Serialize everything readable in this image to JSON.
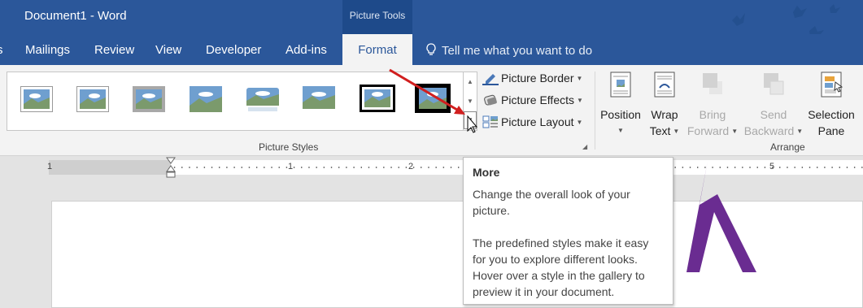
{
  "window": {
    "title": "Document1 - Word",
    "contextual_group": "Picture Tools"
  },
  "tabs": [
    {
      "label": "s"
    },
    {
      "label": "Mailings"
    },
    {
      "label": "Review"
    },
    {
      "label": "View"
    },
    {
      "label": "Developer"
    },
    {
      "label": "Add-ins"
    },
    {
      "label": "Format"
    }
  ],
  "active_tab": "Format",
  "tell_me": {
    "text": "Tell me what you want to do"
  },
  "ribbon": {
    "picture_styles": {
      "label": "Picture Styles",
      "commands": {
        "border": "Picture Border",
        "effects": "Picture Effects",
        "layout": "Picture Layout"
      }
    },
    "arrange": {
      "label": "Arrange",
      "position": {
        "line1": "Position"
      },
      "wrap": {
        "line1": "Wrap",
        "line2": "Text"
      },
      "bring": {
        "line1": "Bring",
        "line2": "Forward"
      },
      "send": {
        "line1": "Send",
        "line2": "Backward"
      },
      "selection": {
        "line1": "Selection",
        "line2": "Pane"
      }
    }
  },
  "ruler": {
    "numbers": [
      "1",
      "1",
      "2",
      "5"
    ]
  },
  "tooltip": {
    "title": "More",
    "line1": "Change the overall look of your picture.",
    "line2": "The predefined styles make it easy for you to explore different looks. Hover over a style in the gallery to preview it in your document."
  },
  "colors": {
    "brand": "#2b579a",
    "annotation_arrow": "#d11f1f",
    "logo": "#6a2c91"
  },
  "icons": [
    "lightbulb-icon",
    "picture-border-icon",
    "picture-effects-icon",
    "picture-layout-icon",
    "position-icon",
    "wrap-text-icon",
    "bring-forward-icon",
    "send-backward-icon",
    "selection-pane-icon",
    "gallery-more-icon"
  ]
}
